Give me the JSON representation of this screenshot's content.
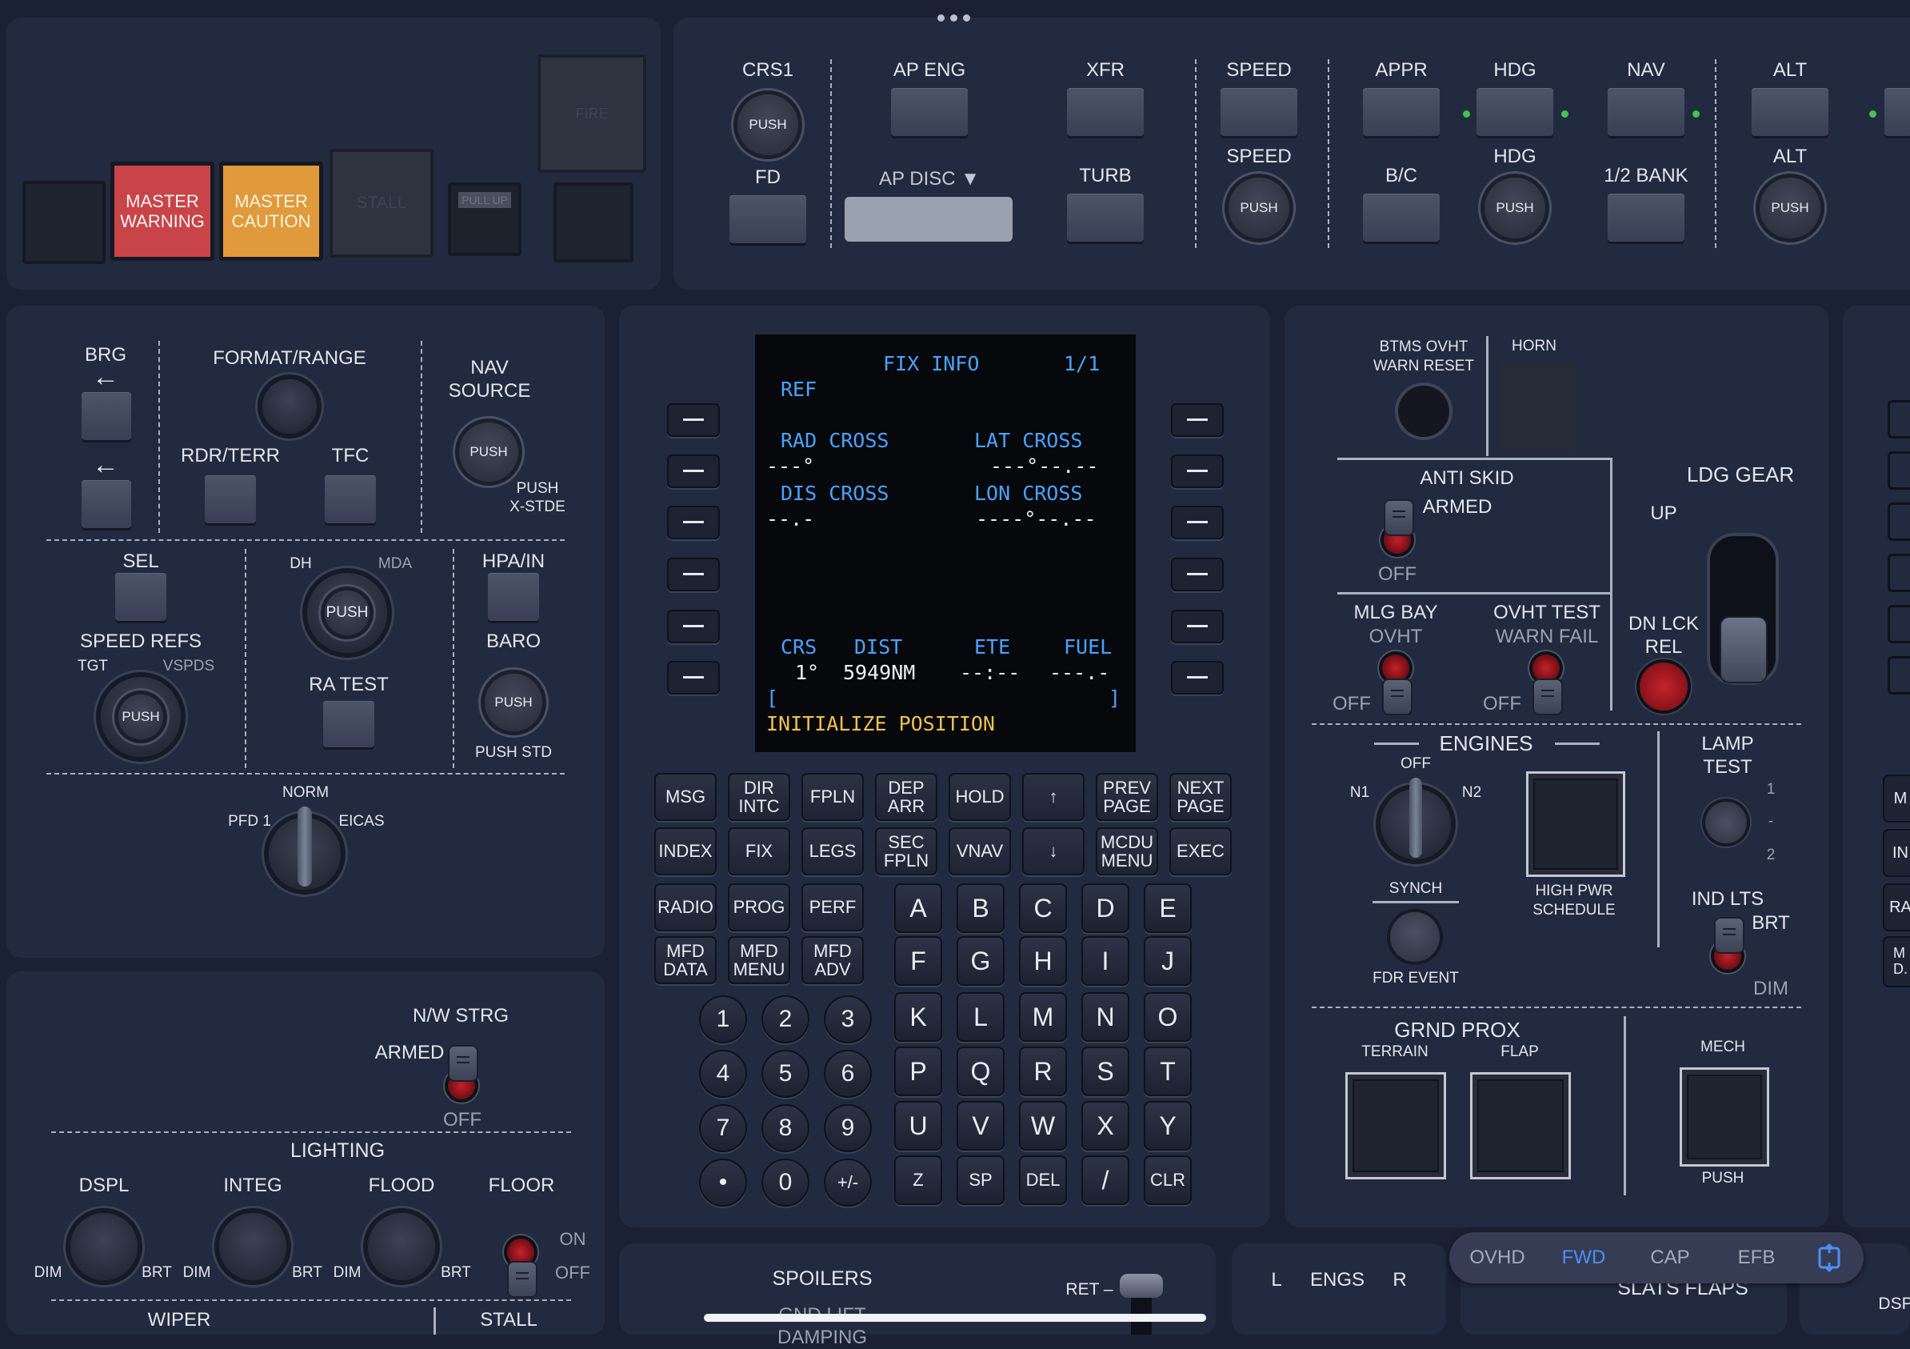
{
  "annunciators": {
    "master_warning": "MASTER\nWARNING",
    "master_caution": "MASTER\nCAUTION",
    "stall": "STALL",
    "pull_up": "PULL UP",
    "fire": "FIRE"
  },
  "mcp": {
    "crs1": "CRS1",
    "push": "PUSH",
    "fd": "FD",
    "ap_eng": "AP ENG",
    "ap_disc": "AP DISC ▼",
    "xfr": "XFR",
    "turb": "TURB",
    "speed_top": "SPEED",
    "speed_knob": "SPEED",
    "appr": "APPR",
    "bc": "B/C",
    "hdg_top": "HDG",
    "hdg_knob": "HDG",
    "nav": "NAV",
    "half_bank": "1/2 BANK",
    "alt_top": "ALT",
    "alt_knob": "ALT"
  },
  "efis": {
    "brg": "BRG",
    "format_range": "FORMAT/RANGE",
    "nav_source": "NAV\nSOURCE",
    "push": "PUSH",
    "push_xstde": "PUSH\nX-STDE",
    "rdr_terr": "RDR/TERR",
    "tfc": "TFC",
    "sel": "SEL",
    "speed_refs": "SPEED REFS",
    "tgt": "TGT",
    "vspds": "VSPDS",
    "dh": "DH",
    "mda": "MDA",
    "ra_test": "RA TEST",
    "hpa_in": "HPA/IN",
    "baro": "BARO",
    "push_std": "PUSH STD",
    "norm": "NORM",
    "pfd1": "PFD 1",
    "eicas": "EICAS",
    "arrow": "←"
  },
  "lower_left": {
    "nw_strg": "N/W STRG",
    "armed": "ARMED",
    "off": "OFF",
    "lighting": "LIGHTING",
    "dspl": "DSPL",
    "integ": "INTEG",
    "flood": "FLOOD",
    "floor": "FLOOR",
    "dim": "DIM",
    "brt": "BRT",
    "on": "ON",
    "wiper": "WIPER",
    "stall": "STALL"
  },
  "cdu": {
    "title": "FIX INFO",
    "page": "1/1",
    "ref": "REF",
    "rad_cross": "RAD CROSS",
    "lat_cross": "LAT CROSS",
    "rad_val": "---°",
    "lat_val": "---°--.--",
    "dis_cross": "DIS CROSS",
    "lon_cross": "LON CROSS",
    "dis_val": "--.-",
    "lon_val": "----°--.--",
    "crs": "CRS",
    "dist": "DIST",
    "ete": "ETE",
    "fuel": "FUEL",
    "crs_val": "1°",
    "dist_val": "5949NM",
    "ete_val": "--:--",
    "fuel_val": "---.-",
    "bracket_l": "[",
    "bracket_r": "]",
    "scratchpad": "INITIALIZE POSITION"
  },
  "fn_keys": [
    [
      "MSG",
      "DIR\nINTC",
      "FPLN",
      "DEP\nARR",
      "HOLD",
      "↑",
      "PREV\nPAGE",
      "NEXT\nPAGE"
    ],
    [
      "INDEX",
      "FIX",
      "LEGS",
      "SEC\nFPLN",
      "VNAV",
      "↓",
      "MCDU\nMENU",
      "EXEC"
    ],
    [
      "RADIO",
      "PROG",
      "PERF"
    ],
    [
      "MFD\nDATA",
      "MFD\nMENU",
      "MFD\nADV"
    ]
  ],
  "letters": [
    [
      "A",
      "B",
      "C",
      "D",
      "E"
    ],
    [
      "F",
      "G",
      "H",
      "I",
      "J"
    ],
    [
      "K",
      "L",
      "M",
      "N",
      "O"
    ],
    [
      "P",
      "Q",
      "R",
      "S",
      "T"
    ],
    [
      "U",
      "V",
      "W",
      "X",
      "Y"
    ],
    [
      "Z",
      "SP",
      "DEL",
      "/",
      "CLR"
    ]
  ],
  "digits": [
    [
      "1",
      "2",
      "3"
    ],
    [
      "4",
      "5",
      "6"
    ],
    [
      "7",
      "8",
      "9"
    ],
    [
      "•",
      "0",
      "+/-"
    ]
  ],
  "right_panel": {
    "btms": "BTMS OVHT\nWARN RESET",
    "horn": "HORN",
    "anti_skid": "ANTI SKID",
    "armed": "ARMED",
    "off": "OFF",
    "ldg_gear": "LDG GEAR",
    "up": "UP",
    "dn_lck_rel": "DN LCK\nREL",
    "mlg_bay": "MLG BAY",
    "ovht": "OVHT",
    "ovht_test": "OVHT TEST",
    "warn_fail": "WARN FAIL",
    "engines": "ENGINES",
    "eng_off": "OFF",
    "n1": "N1",
    "n2": "N2",
    "synch": "SYNCH",
    "high_pwr": "HIGH PWR\nSCHEDULE",
    "fdr_event": "FDR EVENT",
    "lamp_test": "LAMP\nTEST",
    "lamp_1": "1",
    "lamp_dash": "-",
    "lamp_2": "2",
    "ind_lts": "IND LTS",
    "brt": "BRT",
    "dim": "DIM",
    "grnd_prox": "GRND PROX",
    "terrain": "TERRAIN",
    "flap": "FLAP",
    "mech": "MECH",
    "push": "PUSH"
  },
  "bottom": {
    "spoilers": "SPOILERS",
    "gnd_lift": "GND LIFT",
    "damping": "DAMPING",
    "ret": "RET –",
    "l": "L",
    "engs": "ENGS",
    "r": "R",
    "slats_flaps": "SLATS FLAPS",
    "dsp": "DSP"
  },
  "edge_labels": [
    "M",
    "IN",
    "RA",
    "M\nD."
  ],
  "tabs": [
    "OVHD",
    "FWD",
    "CAP",
    "EFB"
  ],
  "active_tab": "FWD",
  "colors": {
    "accent": "#4d8ff6",
    "cdu_cyan": "#4aa3ff",
    "cdu_amber": "#f0c24a",
    "master_warning": "#c94448",
    "master_caution": "#e09a3c"
  }
}
